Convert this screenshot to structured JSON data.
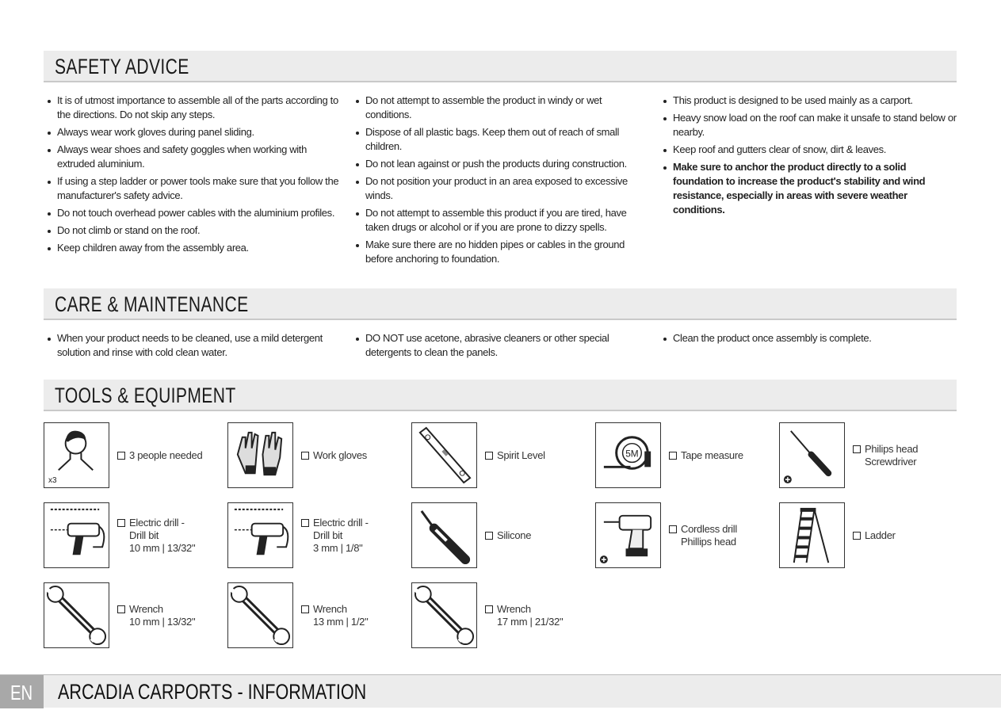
{
  "sections": {
    "safety": {
      "title": "SAFETY ADVICE",
      "col1": [
        "It is of utmost importance to assemble all of the parts according to the directions. Do not skip any steps.",
        "Always wear work gloves during panel sliding.",
        "Always wear shoes and safety goggles when working with extruded aluminium.",
        "If using a step ladder or power tools make sure that you follow the manufacturer's safety advice.",
        "Do not touch overhead power cables with the aluminium profiles.",
        "Do not climb or stand on the roof.",
        "Keep children away from the assembly area."
      ],
      "col2": [
        "Do not attempt to assemble the product in windy or wet conditions.",
        "Dispose of all plastic bags. Keep them out of reach of small children.",
        "Do not lean against or push the products during construction.",
        "Do not position your product in an area exposed to excessive winds.",
        "Do not attempt to assemble this product if you are tired, have taken drugs or alcohol or if you are prone to dizzy spells.",
        "Make sure there are no hidden pipes or cables in the ground before anchoring to foundation."
      ],
      "col3": [
        "This product is designed to be used mainly as a carport.",
        "Heavy snow load on the roof can make it unsafe to stand below or nearby.",
        "Keep roof and gutters clear of snow, dirt & leaves.",
        "Make sure to anchor the product directly to a solid foundation to increase the product's stability and wind resistance, especially in areas with severe weather conditions."
      ]
    },
    "care": {
      "title": "CARE & MAINTENANCE",
      "col1": [
        "When your product needs to be cleaned, use a mild detergent solution and rinse with cold clean water."
      ],
      "col2": [
        "DO NOT use acetone, abrasive cleaners or other special detergents to clean the panels."
      ],
      "col3": [
        "Clean the product once assembly is complete."
      ]
    },
    "tools": {
      "title": "TOOLS & EQUIPMENT",
      "items": [
        {
          "icon": "person-icon",
          "lines": [
            "3 people needed"
          ],
          "badge": "x3"
        },
        {
          "icon": "gloves-icon",
          "lines": [
            "Work gloves"
          ]
        },
        {
          "icon": "spirit-level-icon",
          "lines": [
            "Spirit Level"
          ]
        },
        {
          "icon": "tape-measure-icon",
          "lines": [
            "Tape measure"
          ],
          "badge": "5M"
        },
        {
          "icon": "screwdriver-icon",
          "lines": [
            "Philips head",
            "Screwdriver"
          ]
        },
        {
          "icon": "drill-icon",
          "lines": [
            "Electric drill -",
            "Drill bit",
            "10 mm | 13/32\""
          ]
        },
        {
          "icon": "drill-icon",
          "lines": [
            "Electric drill -",
            "Drill bit",
            "3 mm | 1/8\""
          ]
        },
        {
          "icon": "silicone-icon",
          "lines": [
            "Silicone"
          ]
        },
        {
          "icon": "cordless-drill-icon",
          "lines": [
            "Cordless drill",
            "Phillips head"
          ]
        },
        {
          "icon": "ladder-icon",
          "lines": [
            "Ladder"
          ]
        },
        {
          "icon": "wrench-icon",
          "lines": [
            "Wrench",
            "10 mm | 13/32\""
          ]
        },
        {
          "icon": "wrench-icon",
          "lines": [
            "Wrench",
            "13 mm | 1/2\""
          ]
        },
        {
          "icon": "wrench-icon",
          "lines": [
            "Wrench",
            "17 mm | 21/32\""
          ]
        }
      ]
    }
  },
  "footer": {
    "lang": "EN",
    "title": "ARCADIA CARPORTS - INFORMATION"
  }
}
